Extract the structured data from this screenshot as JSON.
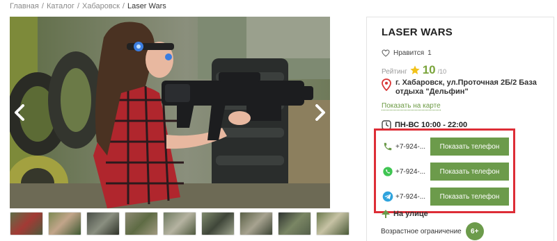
{
  "breadcrumb": {
    "items": [
      "Главная",
      "Каталог",
      "Хабаровск"
    ],
    "current": "Laser Wars",
    "separator": "/"
  },
  "gallery": {
    "prev_icon": "chevron-left-icon",
    "next_icon": "chevron-right-icon",
    "thumbnail_count": 9
  },
  "venue": {
    "title": "LASER WARS",
    "likes_label": "Нравится",
    "likes_count": "1",
    "rating_label": "Рейтинг",
    "rating_value": "10",
    "rating_max": "/10",
    "address": "г. Хабаровск, ул.Проточная 2Б/2 База отдыха \"Дельфин\"",
    "map_link": "Показать на карте",
    "hours": "ПН-ВС 10:00 - 22:00"
  },
  "phones": [
    {
      "icon": "phone-icon",
      "number": "+7-924-...",
      "button": "Показать телефон"
    },
    {
      "icon": "whatsapp-icon",
      "number": "+7-924-...",
      "button": "Показать телефон"
    },
    {
      "icon": "telegram-icon",
      "number": "+7-924-...",
      "button": "Показать телефон"
    }
  ],
  "features": {
    "outdoor": "На улице",
    "age_label": "Возрастное ограничение",
    "age_value": "6+"
  },
  "colors": {
    "accent_green": "#6c9b4b",
    "highlight_red": "#dd2d36",
    "star": "#f2c21a"
  }
}
